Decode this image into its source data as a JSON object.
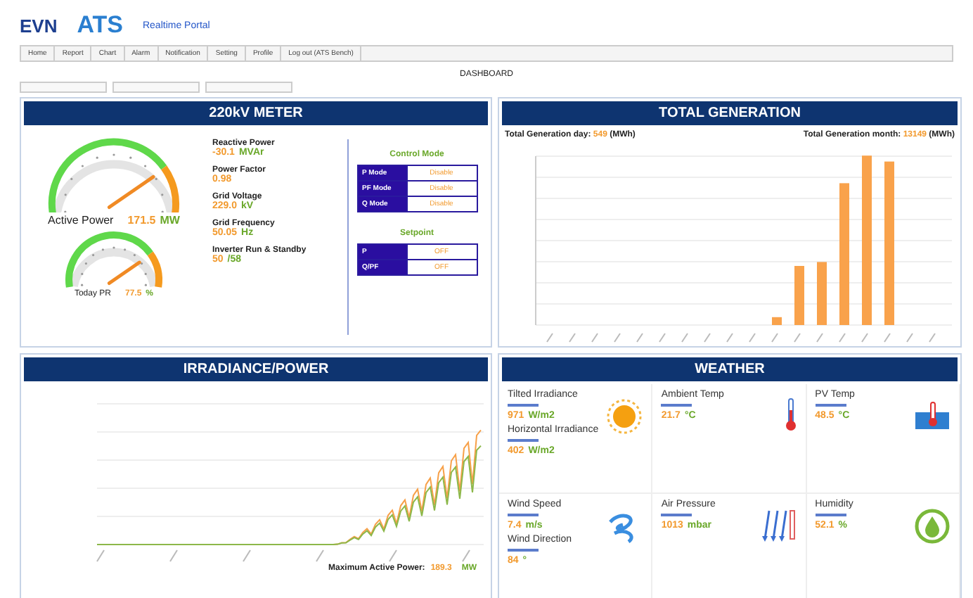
{
  "header": {
    "logo_left": "EVN",
    "logo_right": "ATS",
    "portal_title": "Realtime Portal"
  },
  "nav": [
    {
      "label": "Home",
      "selected": false
    },
    {
      "label": "Report",
      "selected": false
    },
    {
      "label": "Chart",
      "selected": false
    },
    {
      "label": "Alarm",
      "selected": false
    },
    {
      "label": "Notification",
      "selected": false
    },
    {
      "label": "Setting",
      "selected": false
    },
    {
      "label": "Profile",
      "selected": false
    },
    {
      "label": "Log out (ATS Bench)",
      "selected": false
    }
  ],
  "page_title": "DASHBOARD",
  "meter": {
    "title": "220kV METER",
    "gauges": [
      {
        "label": "Active Power",
        "value": "171.5",
        "unit": "MW"
      },
      {
        "label": "Today PR",
        "value": "77.5",
        "unit": "%"
      }
    ],
    "readings": [
      {
        "label": "Reactive Power",
        "value": "-30.1",
        "unit": "MVAr"
      },
      {
        "label": "Power Factor",
        "value": "0.98"
      },
      {
        "label": "Grid Voltage",
        "value": "229.0",
        "unit": "kV"
      },
      {
        "label": "Grid Frequency",
        "value": "50.05",
        "unit": "Hz"
      },
      {
        "label": "Inverter Run & Standby",
        "value": "50",
        "unit": "/58"
      }
    ],
    "control_mode": {
      "title": "Control Mode",
      "rows": [
        {
          "label": "P Mode",
          "value": "Disable"
        },
        {
          "label": "PF Mode",
          "value": "Disable"
        },
        {
          "label": "Q Mode",
          "value": "Disable"
        }
      ]
    },
    "setpoint": {
      "title": "Setpoint",
      "rows": [
        {
          "label": "P",
          "value": "OFF"
        },
        {
          "label": "Q/PF",
          "value": "OFF"
        }
      ]
    }
  },
  "generation": {
    "title": "TOTAL GENERATION",
    "day_label": "Total Generation day:",
    "day_value": "549",
    "day_unit": "(MWh)",
    "month_label": "Total Generation month:",
    "month_value": "13149",
    "month_unit": "(MWh)"
  },
  "irradiance": {
    "title": "IRRADIANCE/POWER",
    "max_label": "Maximum Active Power:",
    "max_value": "189.3",
    "max_unit": "MW"
  },
  "weather": {
    "title": "WEATHER",
    "cells": [
      {
        "kind": "sun",
        "items": [
          {
            "label": "Tilted Irradiance",
            "value": "971",
            "unit": "W/m2"
          },
          {
            "label": "Horizontal Irradiance",
            "value": "402",
            "unit": "W/m2"
          }
        ]
      },
      {
        "kind": "thermometer",
        "items": [
          {
            "label": "Ambient Temp",
            "value": "21.7",
            "unit": "°C"
          }
        ]
      },
      {
        "kind": "panel",
        "items": [
          {
            "label": "PV Temp",
            "value": "48.5",
            "unit": "°C"
          }
        ]
      },
      {
        "kind": "wind",
        "items": [
          {
            "label": "Wind Speed",
            "value": "7.4",
            "unit": "m/s"
          },
          {
            "label": "Wind Direction",
            "value": "84",
            "unit": "°"
          }
        ]
      },
      {
        "kind": "pressure",
        "items": [
          {
            "label": "Air Pressure",
            "value": "1013",
            "unit": "mbar"
          }
        ]
      },
      {
        "kind": "humidity",
        "items": [
          {
            "label": "Humidity",
            "value": "52.1",
            "unit": "%"
          }
        ]
      }
    ]
  }
}
